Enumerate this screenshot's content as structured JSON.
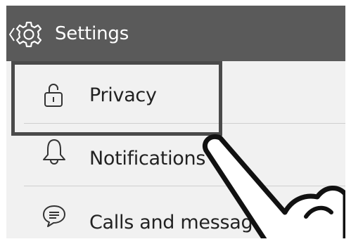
{
  "header": {
    "title": "Settings",
    "back_icon": "chevron-left-icon",
    "settings_icon": "gear-icon"
  },
  "menu": {
    "items": [
      {
        "label": "Privacy",
        "icon": "lock-icon"
      },
      {
        "label": "Notifications",
        "icon": "bell-icon"
      },
      {
        "label": "Calls and messages",
        "icon": "chat-bubble-icon"
      }
    ]
  },
  "colors": {
    "header_bg": "#5a5a5a",
    "list_bg": "#f1f1f1",
    "highlight_border": "#4a4a4a"
  }
}
